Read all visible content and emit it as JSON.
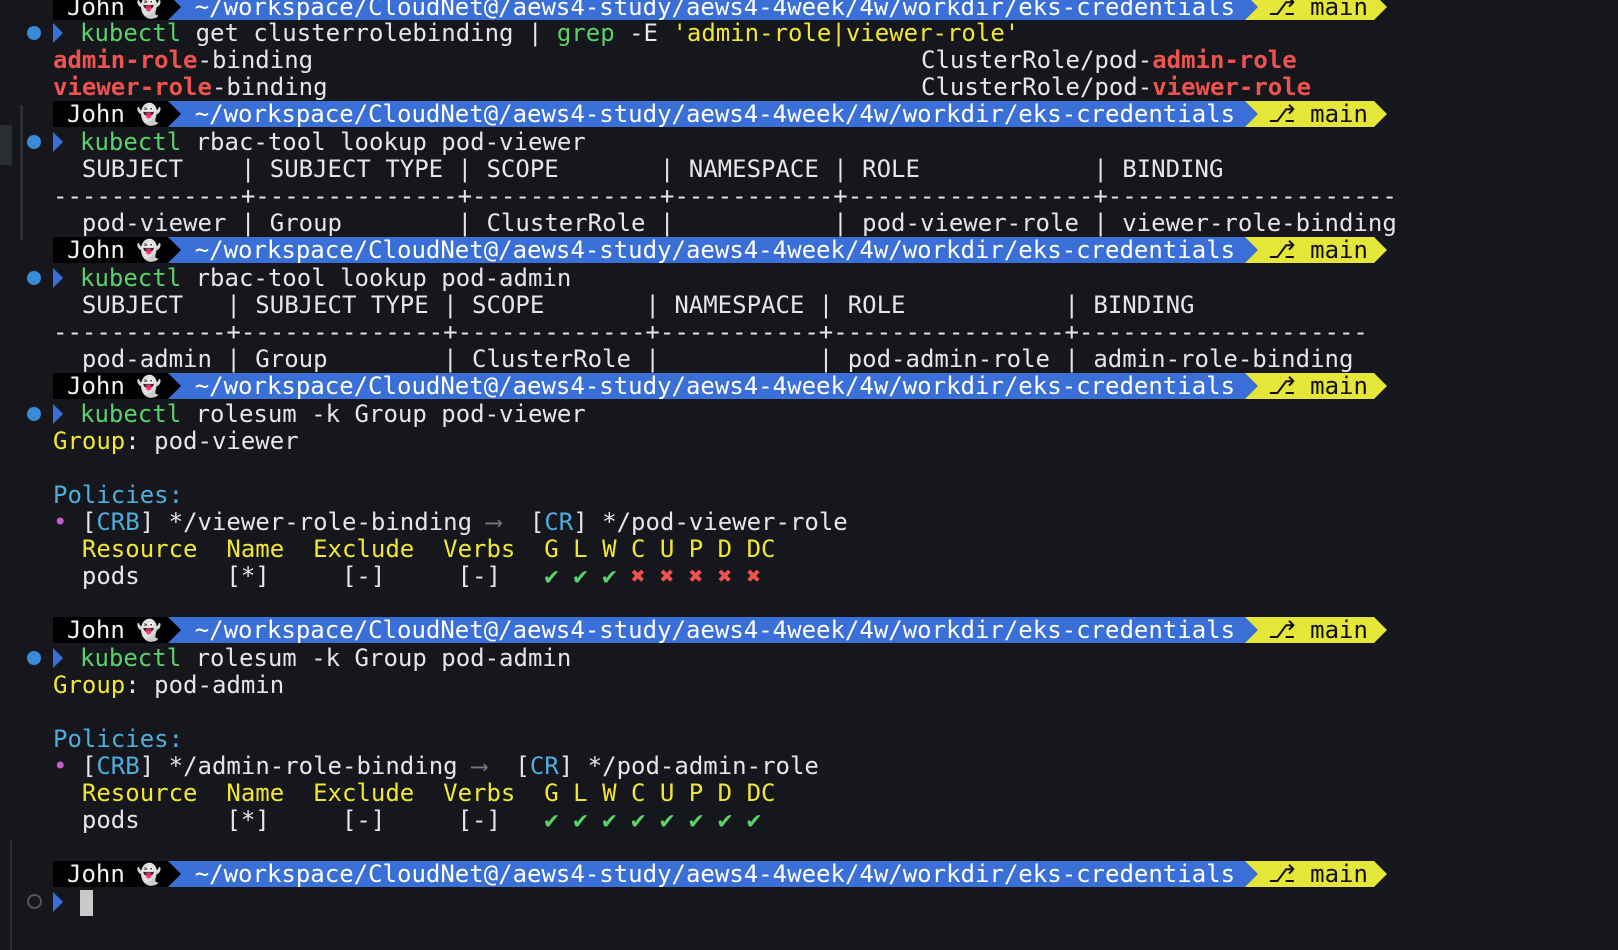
{
  "prompt": {
    "user": "John",
    "ghost": "👻",
    "path": "~/workspace/CloudNet@/aews4-study/aews4-4week/4w/workdir/eks-credentials",
    "branch_icon": "⎇",
    "branch": "main"
  },
  "block1": {
    "cmd_kubectl": "kubectl",
    "cmd_rest1": " get clusterrolebinding | ",
    "cmd_grep": "grep",
    "cmd_flag": " -E ",
    "cmd_pattern": "'admin-role|viewer-role'",
    "rows": [
      {
        "name_hl": "admin-role",
        "name_rest": "-binding",
        "role_prefix": "ClusterRole/pod-",
        "role_hl": "admin-role"
      },
      {
        "name_hl": "viewer-role",
        "name_rest": "-binding",
        "role_prefix": "ClusterRole/pod-",
        "role_hl": "viewer-role"
      }
    ]
  },
  "block2": {
    "cmd_kubectl": "kubectl",
    "cmd_rest": " rbac-tool lookup pod-viewer",
    "header": "  SUBJECT    | SUBJECT TYPE | SCOPE       | NAMESPACE | ROLE            | BINDING",
    "sep": "-------------+--------------+-------------+-----------+-----------------+--------------------",
    "row": "  pod-viewer | Group        | ClusterRole |           | pod-viewer-role | viewer-role-binding"
  },
  "block3": {
    "cmd_kubectl": "kubectl",
    "cmd_rest": " rbac-tool lookup pod-admin",
    "header": "  SUBJECT   | SUBJECT TYPE | SCOPE       | NAMESPACE | ROLE           | BINDING",
    "sep": "------------+--------------+-------------+-----------+----------------+--------------------",
    "row": "  pod-admin | Group        | ClusterRole |           | pod-admin-role | admin-role-binding"
  },
  "block4": {
    "cmd_kubectl": "kubectl",
    "cmd_rest": " rolesum -k Group pod-viewer",
    "group_label": "Group",
    "group_value": ": pod-viewer",
    "policies_label": "Policies:",
    "bullet": "•",
    "crb_open": " [",
    "crb": "CRB",
    "crb_path": "] */viewer-role-binding ",
    "arrow": "⟶",
    "cr_open": "  [",
    "cr": "CR",
    "cr_path": "] */pod-viewer-role",
    "cols": "  Resource  Name  Exclude  Verbs  G L W C U P D DC",
    "res_row": "  pods      [*]     [-]     [-]   ",
    "verbs": [
      "✔",
      "✔",
      "✔",
      "✖",
      "✖",
      "✖",
      "✖",
      "✖"
    ]
  },
  "block5": {
    "cmd_kubectl": "kubectl",
    "cmd_rest": " rolesum -k Group pod-admin",
    "group_label": "Group",
    "group_value": ": pod-admin",
    "policies_label": "Policies:",
    "bullet": "•",
    "crb_open": " [",
    "crb": "CRB",
    "crb_path": "] */admin-role-binding ",
    "arrow": "⟶",
    "cr_open": "  [",
    "cr": "CR",
    "cr_path": "] */pod-admin-role",
    "cols": "  Resource  Name  Exclude  Verbs  G L W C U P D DC",
    "res_row": "  pods      [*]     [-]     [-]   ",
    "verbs": [
      "✔",
      "✔",
      "✔",
      "✔",
      "✔",
      "✔",
      "✔",
      "✔"
    ]
  }
}
